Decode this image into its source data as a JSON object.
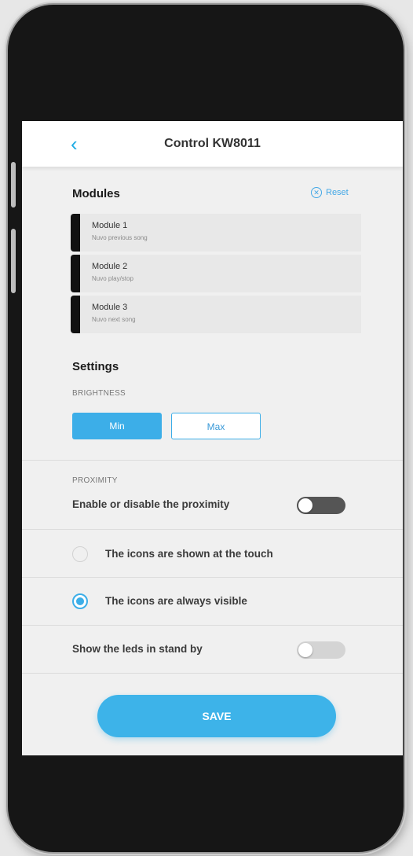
{
  "header": {
    "back_icon": "chevron-left-icon",
    "back_glyph": "‹",
    "title": "Control KW8011"
  },
  "modules_section": {
    "title": "Modules",
    "reset_label": "Reset",
    "reset_glyph": "✕",
    "items": [
      {
        "name": "Module 1",
        "description": "Nuvo previous song"
      },
      {
        "name": "Module 2",
        "description": "Nuvo play/stop"
      },
      {
        "name": "Module 3",
        "description": "Nuvo next song"
      }
    ]
  },
  "settings_section": {
    "title": "Settings",
    "brightness": {
      "label": "BRIGHTNESS",
      "options": [
        "Min",
        "Max"
      ],
      "selected": "Min"
    },
    "proximity": {
      "label": "PROXIMITY",
      "toggle_label": "Enable or disable the proximity",
      "enabled": false
    },
    "icons_mode": {
      "options": [
        {
          "label": "The icons are shown at the touch",
          "selected": false
        },
        {
          "label": "The icons are always visible",
          "selected": true
        }
      ]
    },
    "standby_leds": {
      "label": "Show the leds in stand by",
      "enabled": false
    }
  },
  "save_label": "SAVE",
  "colors": {
    "accent": "#3caee8",
    "toggle_off_dark": "#555555",
    "toggle_off_light": "#d4d4d4"
  }
}
